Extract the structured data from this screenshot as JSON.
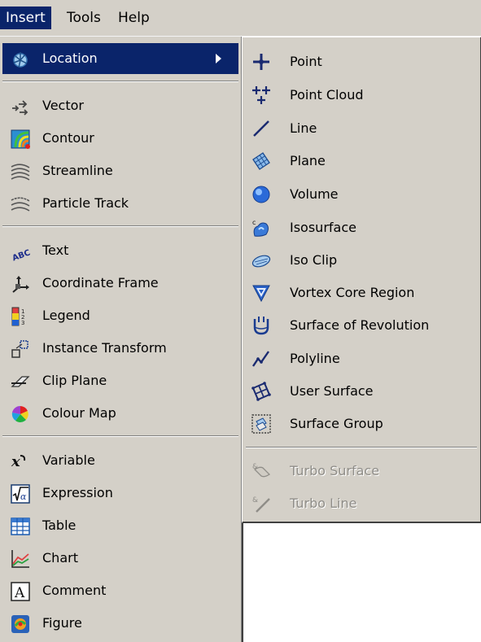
{
  "menubar": {
    "items": [
      {
        "label": "Insert"
      },
      {
        "label": "Tools"
      },
      {
        "label": "Help"
      }
    ]
  },
  "insert_menu": {
    "items": [
      {
        "label": "Location",
        "icon": "location-icon",
        "has_submenu": true
      },
      {
        "label": "Vector",
        "icon": "vector-icon"
      },
      {
        "label": "Contour",
        "icon": "contour-icon"
      },
      {
        "label": "Streamline",
        "icon": "streamline-icon"
      },
      {
        "label": "Particle Track",
        "icon": "particle-track-icon"
      },
      {
        "label": "Text",
        "icon": "text-abc-icon"
      },
      {
        "label": "Coordinate Frame",
        "icon": "coordinate-frame-icon"
      },
      {
        "label": "Legend",
        "icon": "legend-icon"
      },
      {
        "label": "Instance Transform",
        "icon": "instance-transform-icon"
      },
      {
        "label": "Clip Plane",
        "icon": "clip-plane-icon"
      },
      {
        "label": "Colour Map",
        "icon": "colour-map-icon"
      },
      {
        "label": "Variable",
        "icon": "variable-icon"
      },
      {
        "label": "Expression",
        "icon": "expression-icon"
      },
      {
        "label": "Table",
        "icon": "table-icon"
      },
      {
        "label": "Chart",
        "icon": "chart-icon"
      },
      {
        "label": "Comment",
        "icon": "comment-icon"
      },
      {
        "label": "Figure",
        "icon": "figure-icon"
      }
    ]
  },
  "location_submenu": {
    "items": [
      {
        "label": "Point",
        "icon": "point-icon"
      },
      {
        "label": "Point Cloud",
        "icon": "point-cloud-icon"
      },
      {
        "label": "Line",
        "icon": "line-icon"
      },
      {
        "label": "Plane",
        "icon": "plane-icon"
      },
      {
        "label": "Volume",
        "icon": "volume-icon"
      },
      {
        "label": "Isosurface",
        "icon": "isosurface-icon"
      },
      {
        "label": "Iso Clip",
        "icon": "iso-clip-icon"
      },
      {
        "label": "Vortex Core Region",
        "icon": "vortex-core-icon"
      },
      {
        "label": "Surface of Revolution",
        "icon": "surface-of-revolution-icon"
      },
      {
        "label": "Polyline",
        "icon": "polyline-icon"
      },
      {
        "label": "User Surface",
        "icon": "user-surface-icon"
      },
      {
        "label": "Surface Group",
        "icon": "surface-group-icon"
      },
      {
        "label": "Turbo Surface",
        "icon": "turbo-surface-icon",
        "disabled": true
      },
      {
        "label": "Turbo Line",
        "icon": "turbo-line-icon",
        "disabled": true
      }
    ]
  },
  "colors": {
    "menu_bg": "#d4d0c8",
    "highlight": "#0a246a",
    "disabled_text": "#8f8d88"
  }
}
